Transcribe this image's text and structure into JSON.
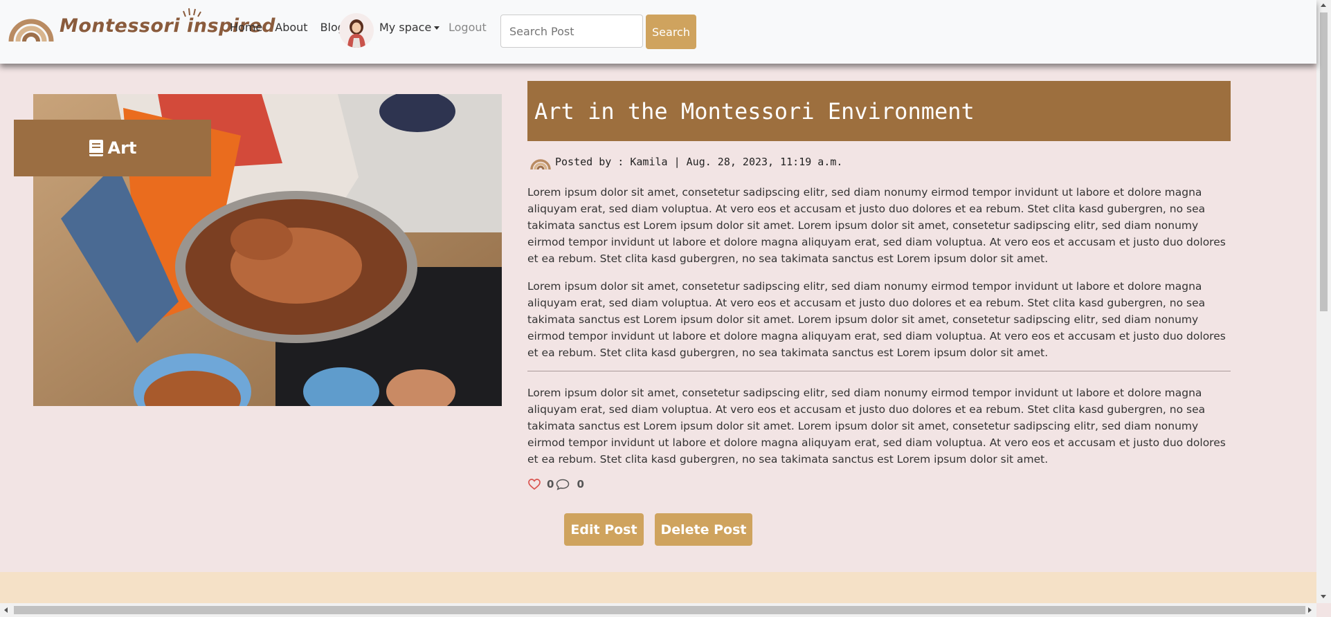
{
  "brand": {
    "name": "Montessori inspired"
  },
  "nav": {
    "links": [
      "Home",
      "About",
      "Blog"
    ],
    "my_space": "My space",
    "logout": "Logout"
  },
  "search": {
    "placeholder": "Search Post",
    "button": "Search"
  },
  "category": {
    "label": "Art",
    "icon": "book-icon"
  },
  "post": {
    "title": "Art in the Montessori Environment",
    "meta": "Posted by : Kamila | Aug. 28, 2023, 11:19 a.m.",
    "paragraphs": [
      "Lorem ipsum dolor sit amet, consetetur sadipscing elitr, sed diam nonumy eirmod tempor invidunt ut labore et dolore magna aliquyam erat, sed diam voluptua. At vero eos et accusam et justo duo dolores et ea rebum. Stet clita kasd gubergren, no sea takimata sanctus est Lorem ipsum dolor sit amet. Lorem ipsum dolor sit amet, consetetur sadipscing elitr, sed diam nonumy eirmod tempor invidunt ut labore et dolore magna aliquyam erat, sed diam voluptua. At vero eos et accusam et justo duo dolores et ea rebum. Stet clita kasd gubergren, no sea takimata sanctus est Lorem ipsum dolor sit amet.",
      "Lorem ipsum dolor sit amet, consetetur sadipscing elitr, sed diam nonumy eirmod tempor invidunt ut labore et dolore magna aliquyam erat, sed diam voluptua. At vero eos et accusam et justo duo dolores et ea rebum. Stet clita kasd gubergren, no sea takimata sanctus est Lorem ipsum dolor sit amet. Lorem ipsum dolor sit amet, consetetur sadipscing elitr, sed diam nonumy eirmod tempor invidunt ut labore et dolore magna aliquyam erat, sed diam voluptua. At vero eos et accusam et justo duo dolores et ea rebum. Stet clita kasd gubergren, no sea takimata sanctus est Lorem ipsum dolor sit amet.",
      "Lorem ipsum dolor sit amet, consetetur sadipscing elitr, sed diam nonumy eirmod tempor invidunt ut labore et dolore magna aliquyam erat, sed diam voluptua. At vero eos et accusam et justo duo dolores et ea rebum. Stet clita kasd gubergren, no sea takimata sanctus est Lorem ipsum dolor sit amet. Lorem ipsum dolor sit amet, consetetur sadipscing elitr, sed diam nonumy eirmod tempor invidunt ut labore et dolore magna aliquyam erat, sed diam voluptua. At vero eos et accusam et justo duo dolores et ea rebum. Stet clita kasd gubergren, no sea takimata sanctus est Lorem ipsum dolor sit amet."
    ],
    "likes": "0",
    "comments": "0"
  },
  "actions": {
    "edit": "Edit Post",
    "delete": "Delete Post"
  },
  "colors": {
    "accent": "#cfa35e",
    "title_bg": "#9d6f3e",
    "badge_bg": "#9b6e42",
    "page_bg": "#f2e4e4",
    "footer_bg": "#f5e1c7",
    "heart": "#d9534f"
  }
}
